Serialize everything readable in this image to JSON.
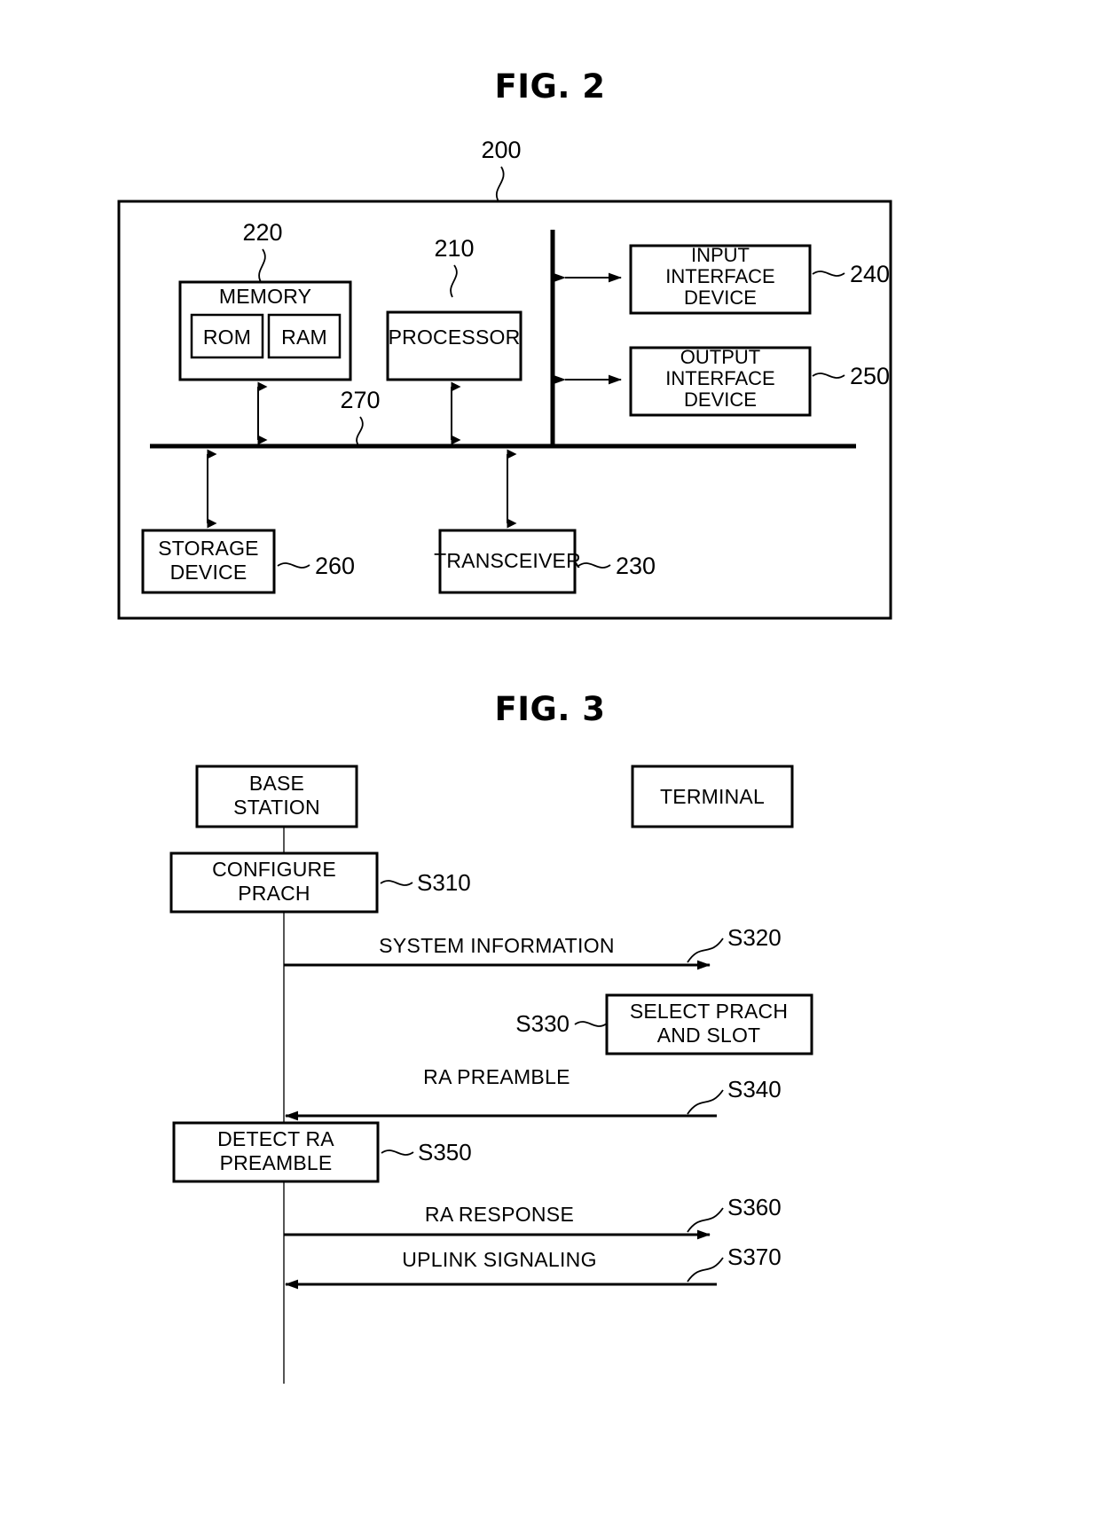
{
  "document": {
    "type": "patent-figure-sheet",
    "figures": [
      "FIG. 2",
      "FIG. 3"
    ]
  },
  "fig2": {
    "title": "FIG. 2",
    "system_ref": "200",
    "blocks": {
      "memory": {
        "label": "MEMORY",
        "ref": "220"
      },
      "rom": {
        "label": "ROM"
      },
      "ram": {
        "label": "RAM"
      },
      "processor": {
        "label": "PROCESSOR",
        "ref": "210"
      },
      "input_interface": {
        "line1": "INPUT",
        "line2": "INTERFACE",
        "line3": "DEVICE",
        "ref": "240"
      },
      "output_interface": {
        "line1": "OUTPUT",
        "line2": "INTERFACE",
        "line3": "DEVICE",
        "ref": "250"
      },
      "storage": {
        "line1": "STORAGE",
        "line2": "DEVICE",
        "ref": "260"
      },
      "transceiver": {
        "label": "TRANSCEIVER",
        "ref": "230"
      },
      "bus": {
        "ref": "270"
      }
    }
  },
  "fig3": {
    "title": "FIG. 3",
    "actors": {
      "base_station": {
        "line1": "BASE",
        "line2": "STATION"
      },
      "terminal": {
        "label": "TERMINAL"
      }
    },
    "steps": [
      {
        "id": "S310",
        "kind": "process",
        "actor": "base_station",
        "line1": "CONFIGURE",
        "line2": "PRACH"
      },
      {
        "id": "S320",
        "kind": "message",
        "label": "SYSTEM INFORMATION",
        "direction": "base_station-to-terminal"
      },
      {
        "id": "S330",
        "kind": "process",
        "actor": "terminal",
        "line1": "SELECT PRACH",
        "line2": "AND SLOT"
      },
      {
        "id": "S340",
        "kind": "message",
        "label": "RA PREAMBLE",
        "direction": "terminal-to-base_station"
      },
      {
        "id": "S350",
        "kind": "process",
        "actor": "base_station",
        "line1": "DETECT RA",
        "line2": "PREAMBLE"
      },
      {
        "id": "S360",
        "kind": "message",
        "label": "RA RESPONSE",
        "direction": "base_station-to-terminal"
      },
      {
        "id": "S370",
        "kind": "message",
        "label": "UPLINK SIGNALING",
        "direction": "terminal-to-base_station"
      }
    ]
  },
  "colors": {
    "ink": "#000000",
    "paper": "#ffffff",
    "lifeline": "#555555"
  }
}
